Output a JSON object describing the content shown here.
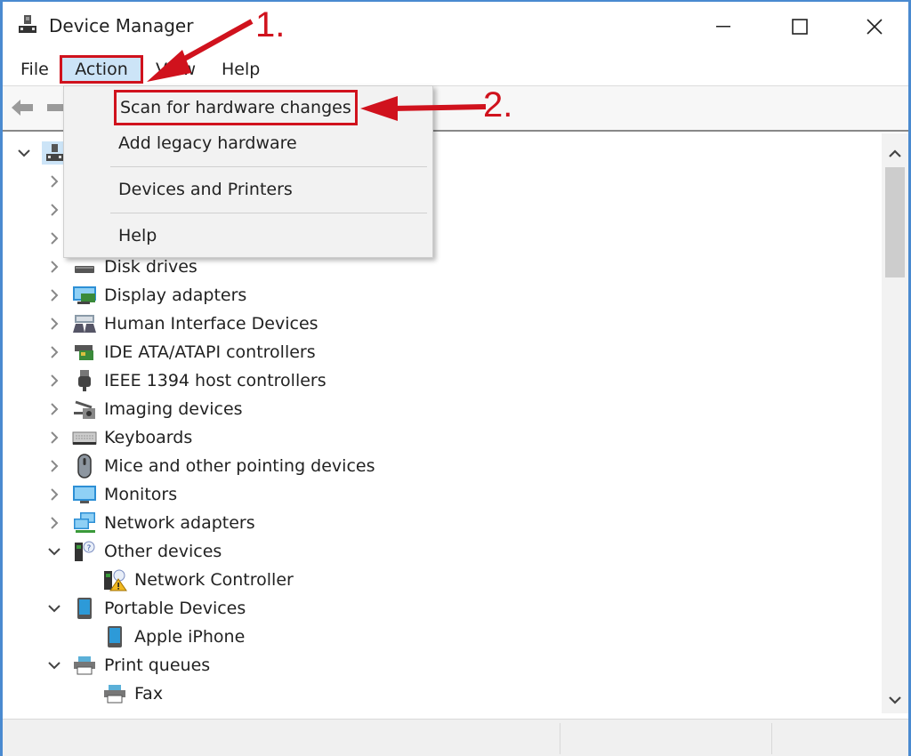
{
  "window": {
    "title": "Device Manager",
    "icon": "device-manager-icon",
    "controls": [
      "minimize",
      "maximize",
      "close"
    ]
  },
  "menubar": {
    "items": [
      {
        "label": "File"
      },
      {
        "label": "Action",
        "active": true
      },
      {
        "label": "View"
      },
      {
        "label": "Help"
      }
    ]
  },
  "action_menu": {
    "items": [
      {
        "label": "Scan for hardware changes",
        "highlighted": true
      },
      {
        "label": "Add legacy hardware"
      },
      {
        "label": "Devices and Printers"
      },
      {
        "label": "Help"
      }
    ]
  },
  "toolbar": {
    "buttons": [
      {
        "icon": "back-arrow-icon"
      },
      {
        "icon": "forward-arrow-icon"
      }
    ]
  },
  "tree": {
    "items": [
      {
        "label": "",
        "level": 0,
        "expanded": true,
        "icon": "computer-icon"
      },
      {
        "label": "",
        "level": 1,
        "expanded": false
      },
      {
        "label": "",
        "level": 1,
        "expanded": false
      },
      {
        "label": "",
        "level": 1,
        "expanded": false
      },
      {
        "label": "Disk drives",
        "level": 1,
        "expanded": false,
        "icon": "disk-drive-icon"
      },
      {
        "label": "Display adapters",
        "level": 1,
        "expanded": false,
        "icon": "display-adapter-icon"
      },
      {
        "label": "Human Interface Devices",
        "level": 1,
        "expanded": false,
        "icon": "hid-icon"
      },
      {
        "label": "IDE ATA/ATAPI controllers",
        "level": 1,
        "expanded": false,
        "icon": "ide-controller-icon"
      },
      {
        "label": "IEEE 1394 host controllers",
        "level": 1,
        "expanded": false,
        "icon": "firewire-icon"
      },
      {
        "label": "Imaging devices",
        "level": 1,
        "expanded": false,
        "icon": "camera-icon"
      },
      {
        "label": "Keyboards",
        "level": 1,
        "expanded": false,
        "icon": "keyboard-icon"
      },
      {
        "label": "Mice and other pointing devices",
        "level": 1,
        "expanded": false,
        "icon": "mouse-icon"
      },
      {
        "label": "Monitors",
        "level": 1,
        "expanded": false,
        "icon": "monitor-icon"
      },
      {
        "label": "Network adapters",
        "level": 1,
        "expanded": false,
        "icon": "network-adapter-icon"
      },
      {
        "label": "Other devices",
        "level": 1,
        "expanded": true,
        "icon": "unknown-device-icon"
      },
      {
        "label": "Network Controller",
        "level": 2,
        "icon": "warning-device-icon"
      },
      {
        "label": "Portable Devices",
        "level": 1,
        "expanded": true,
        "icon": "portable-device-icon"
      },
      {
        "label": "Apple iPhone",
        "level": 2,
        "icon": "portable-device-icon"
      },
      {
        "label": "Print queues",
        "level": 1,
        "expanded": true,
        "icon": "printer-icon"
      },
      {
        "label": "Fax",
        "level": 2,
        "icon": "printer-icon"
      }
    ]
  },
  "annotations": {
    "step1": "1.",
    "step2": "2.",
    "color": "#d0121d"
  },
  "colors": {
    "accent": "#4a8ad0",
    "menu_highlight": "#cce4f7",
    "annotation_red": "#d0121d"
  }
}
